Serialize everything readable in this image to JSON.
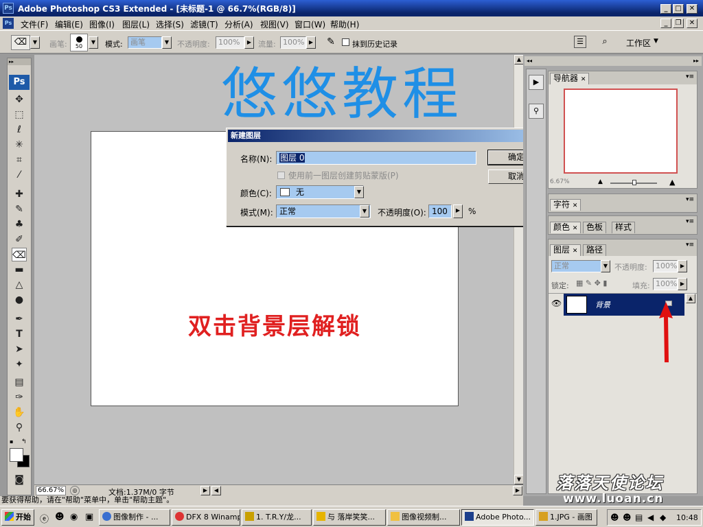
{
  "window": {
    "title": "Adobe Photoshop CS3 Extended - [未标题-1 @ 66.7%(RGB/8)]"
  },
  "menu": [
    "文件(F)",
    "编辑(E)",
    "图像(I)",
    "图层(L)",
    "选择(S)",
    "滤镜(T)",
    "分析(A)",
    "视图(V)",
    "窗口(W)",
    "帮助(H)"
  ],
  "options": {
    "brush_label": "画笔:",
    "brush_size": "50",
    "mode_label": "模式:",
    "mode_value": "画笔",
    "opacity_label": "不透明度:",
    "opacity_value": "100%",
    "flow_label": "流量:",
    "flow_value": "100%",
    "erase_history_label": "抹到历史记录",
    "workspace_label": "工作区"
  },
  "canvas": {
    "overlay_title": "悠悠教程",
    "overlay_caption": "双击背景层解锁"
  },
  "dialog": {
    "title": "新建图层",
    "name_label": "名称(N):",
    "name_value": "图层 0",
    "clip_label": "使用前一图层创建剪贴蒙版(P)",
    "color_label": "颜色(C):",
    "color_value": "无",
    "mode_label": "模式(M):",
    "mode_value": "正常",
    "opacity_label": "不透明度(O):",
    "opacity_value": "100",
    "percent": "%",
    "ok": "确定",
    "cancel": "取消"
  },
  "navigator": {
    "tab": "导航器",
    "zoom": "6.67%"
  },
  "char_panel": {
    "tab": "字符"
  },
  "color_panel": {
    "tabs": [
      "颜色",
      "色板",
      "样式"
    ]
  },
  "layers_panel": {
    "tabs": [
      "图层",
      "路径"
    ],
    "blend_mode": "正常",
    "opacity_label": "不透明度:",
    "opacity_value": "100%",
    "lock_label": "锁定:",
    "fill_label": "填充:",
    "fill_value": "100%",
    "layer_name": "背景"
  },
  "status": {
    "zoom": "66.67%",
    "doc": "文档:1.37M/0 字节"
  },
  "helpbar": "要获得帮助，请在\"帮助\"菜单中，单击\"帮助主题\"。",
  "watermark": {
    "forum": "落落天使论坛",
    "url": "www.luoan.cn"
  },
  "taskbar": {
    "start": "开始",
    "items": [
      "图像制作 - ...",
      "DFX 8 Winamp",
      "1. T.R.Y/龙...",
      "与 落岸笑笑...",
      "图像视频制...",
      "Adobe Photo...",
      "1.JPG - 画图"
    ],
    "clock": "10:48"
  }
}
